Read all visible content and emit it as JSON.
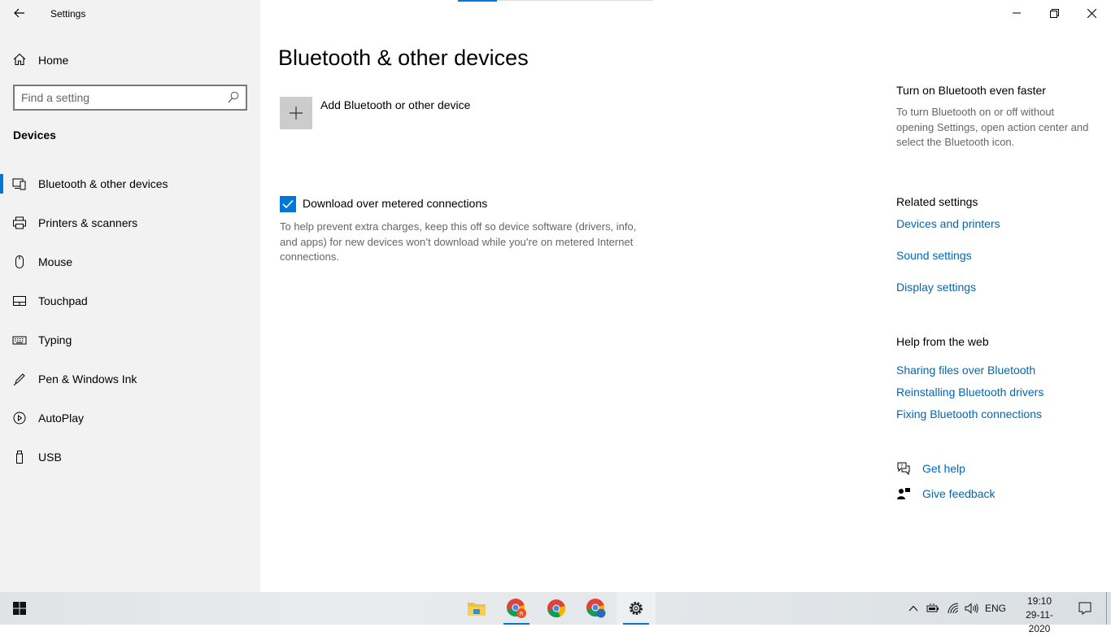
{
  "window": {
    "app_title": "Settings"
  },
  "sidebar": {
    "home_label": "Home",
    "search_placeholder": "Find a setting",
    "section_title": "Devices",
    "items": [
      {
        "label": "Bluetooth & other devices",
        "icon": "bluetooth-devices-icon",
        "active": true
      },
      {
        "label": "Printers & scanners",
        "icon": "printer-icon",
        "active": false
      },
      {
        "label": "Mouse",
        "icon": "mouse-icon",
        "active": false
      },
      {
        "label": "Touchpad",
        "icon": "touchpad-icon",
        "active": false
      },
      {
        "label": "Typing",
        "icon": "keyboard-icon",
        "active": false
      },
      {
        "label": "Pen & Windows Ink",
        "icon": "pen-icon",
        "active": false
      },
      {
        "label": "AutoPlay",
        "icon": "autoplay-icon",
        "active": false
      },
      {
        "label": "USB",
        "icon": "usb-icon",
        "active": false
      }
    ]
  },
  "main": {
    "title": "Bluetooth & other devices",
    "add_device_label": "Add Bluetooth or other device",
    "metered_label": "Download over metered connections",
    "metered_checked": true,
    "metered_description": "To help prevent extra charges, keep this off so device software (drivers, info, and apps) for new devices won’t download while you’re on metered Internet connections."
  },
  "right_panel": {
    "tip_title": "Turn on Bluetooth even faster",
    "tip_text": "To turn Bluetooth on or off without opening Settings, open action center and select the Bluetooth icon.",
    "related_title": "Related settings",
    "related_links": [
      "Devices and printers",
      "Sound settings",
      "Display settings"
    ],
    "help_title": "Help from the web",
    "help_links": [
      "Sharing files over Bluetooth",
      "Reinstalling Bluetooth drivers",
      "Fixing Bluetooth connections"
    ],
    "get_help": "Get help",
    "give_feedback": "Give feedback"
  },
  "taskbar": {
    "language": "ENG",
    "time": "19:10",
    "date": "29-11-2020",
    "apps": [
      "file-explorer",
      "chrome-profile-r",
      "chrome",
      "chrome-profile-b",
      "settings"
    ]
  },
  "colors": {
    "accent": "#0078d7",
    "link": "#0067b8",
    "sidebar_bg": "#f2f2f2"
  }
}
